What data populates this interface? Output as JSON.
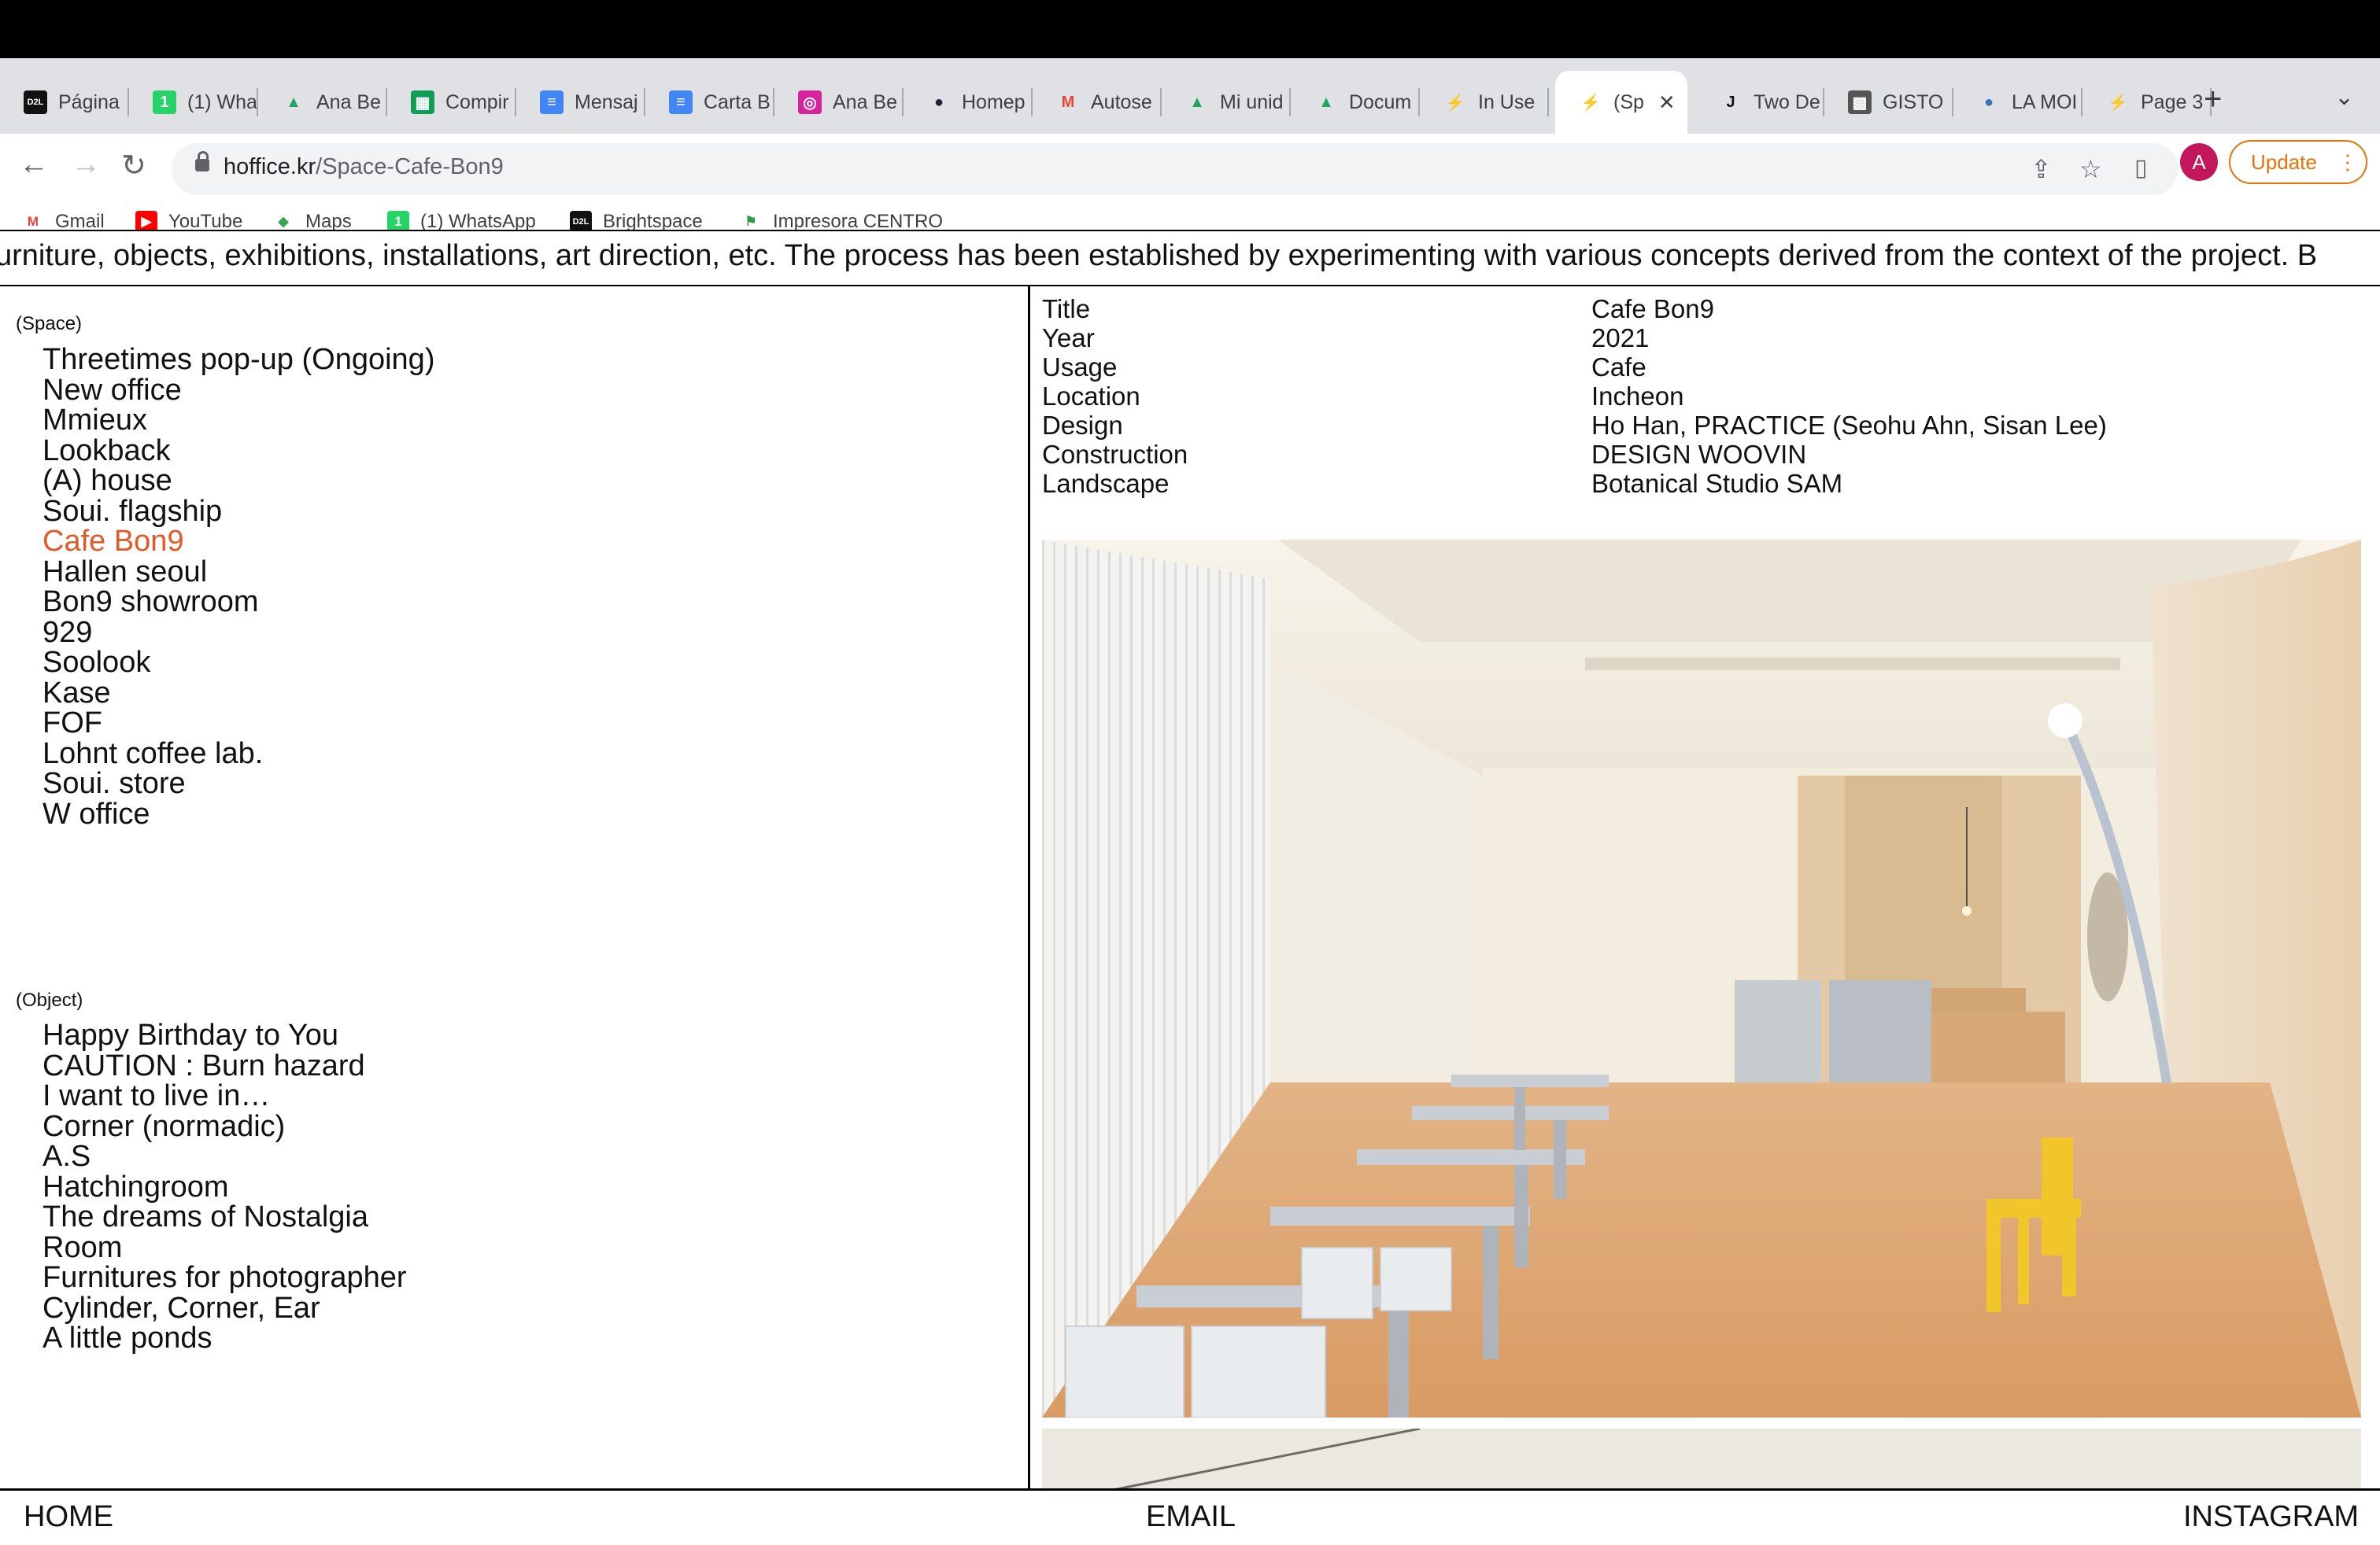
{
  "browser": {
    "tabs": [
      {
        "label": "Página",
        "icon": "d2l-icon"
      },
      {
        "label": "(1) Wha",
        "icon": "whatsapp-icon"
      },
      {
        "label": "Ana Be",
        "icon": "google-drive-icon"
      },
      {
        "label": "Compir",
        "icon": "google-sheets-icon"
      },
      {
        "label": "Mensaj",
        "icon": "google-docs-icon"
      },
      {
        "label": "Carta B",
        "icon": "google-docs-icon"
      },
      {
        "label": "Ana Be",
        "icon": "instagram-icon"
      },
      {
        "label": "Homep",
        "icon": "dark-circle-icon"
      },
      {
        "label": "Autose",
        "icon": "gmail-icon"
      },
      {
        "label": "Mi unid",
        "icon": "google-drive-icon"
      },
      {
        "label": "Docum",
        "icon": "google-drive-icon"
      },
      {
        "label": "In Use",
        "icon": "bolt-icon"
      },
      {
        "label": "(Sp",
        "icon": "bolt-icon",
        "active": true
      },
      {
        "label": "Two De",
        "icon": "j-logo-icon"
      },
      {
        "label": "GISTO",
        "icon": "gisto-icon"
      },
      {
        "label": "LA MOI",
        "icon": "globe-icon"
      },
      {
        "label": "Page 3",
        "icon": "bolt-icon"
      }
    ],
    "close_tab": "✕",
    "new_tab": "+",
    "tab_menu": "⌄",
    "back": "←",
    "forward": "→",
    "reload": "↻",
    "url_domain": "hoffice.kr",
    "url_path": "/Space-Cafe-Bon9",
    "avatar_letter": "A",
    "update_label": "Update",
    "update_menu": "⋮",
    "bookmarks": [
      {
        "label": "Gmail",
        "icon": "gmail-icon"
      },
      {
        "label": "YouTube",
        "icon": "youtube-icon"
      },
      {
        "label": "Maps",
        "icon": "google-maps-icon"
      },
      {
        "label": "(1) WhatsApp",
        "icon": "whatsapp-icon"
      },
      {
        "label": "Brightspace",
        "icon": "d2l-icon"
      },
      {
        "label": "Impresora CENTRO",
        "icon": "flag-icon"
      }
    ],
    "colors": {
      "tabstrip": "#dfe1e5",
      "update": "#e8710a",
      "avatar": "#c2185b"
    }
  },
  "page": {
    "marquee": "urniture, objects, exhibitions, installations, art direction, etc. The process has been established by experimenting with various concepts derived from the context of the project. B",
    "space_label": "(Space)",
    "space_items": [
      "Threetimes pop-up (Ongoing)",
      "New office",
      "Mmieux",
      "Lookback",
      "(A) house",
      "Soui. flagship",
      "Cafe Bon9",
      "Hallen seoul",
      "Bon9 showroom",
      "929",
      "Soolook",
      "Kase",
      "FOF",
      "Lohnt coffee lab.",
      "Soui. store",
      "W office"
    ],
    "active_item": "Cafe Bon9",
    "object_label": "(Object)",
    "object_items": [
      "Happy Birthday to You",
      "CAUTION : Burn hazard",
      "I want to live in…",
      "Corner (normadic)",
      "A.S",
      "Hatchingroom",
      "The dreams of Nostalgia",
      "Room",
      "Furnitures for photographer",
      "Cylinder, Corner, Ear",
      "A little ponds"
    ],
    "info": [
      {
        "key": "Title",
        "value": "Cafe Bon9"
      },
      {
        "key": "Year",
        "value": "2021"
      },
      {
        "key": "Usage",
        "value": "Cafe"
      },
      {
        "key": "Location",
        "value": "Incheon"
      },
      {
        "key": "Design",
        "value": "Ho Han, PRACTICE (Seohu Ahn, Sisan Lee)"
      },
      {
        "key": "Construction",
        "value": "DESIGN WOOVIN"
      },
      {
        "key": "Landscape",
        "value": "Botanical Studio SAM"
      }
    ],
    "accent_color": "#e05a2a",
    "footer": {
      "home": "HOME",
      "email": "EMAIL",
      "instagram": "INSTAGRAM"
    }
  }
}
